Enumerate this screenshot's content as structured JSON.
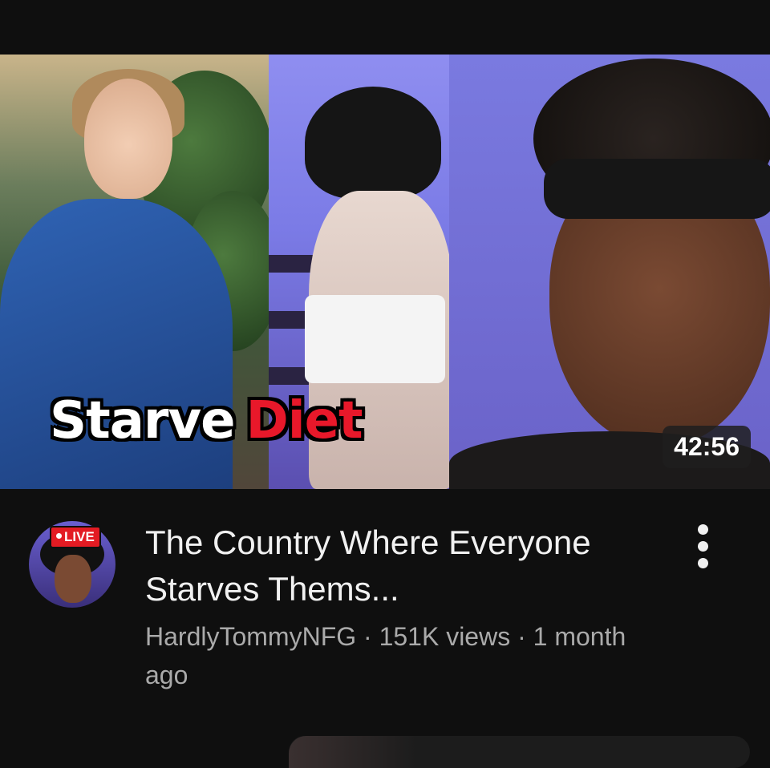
{
  "video": {
    "thumbnail_text_word1": "Starve",
    "thumbnail_text_word2": "Diet",
    "duration": "42:56",
    "title": "The Country Where Everyone Starves Thems...",
    "channel_name": "HardlyTommyNFG",
    "separator": "·",
    "views": "151K views",
    "age": "1 month ago",
    "live_badge": "LIVE"
  },
  "icons": {
    "menu": "more-vert-icon"
  },
  "colors": {
    "background": "#0f0f0f",
    "title_text": "#f1f1f1",
    "meta_text": "#aaaaaa",
    "live_red": "#e31b23",
    "diet_red": "#e8182a"
  }
}
